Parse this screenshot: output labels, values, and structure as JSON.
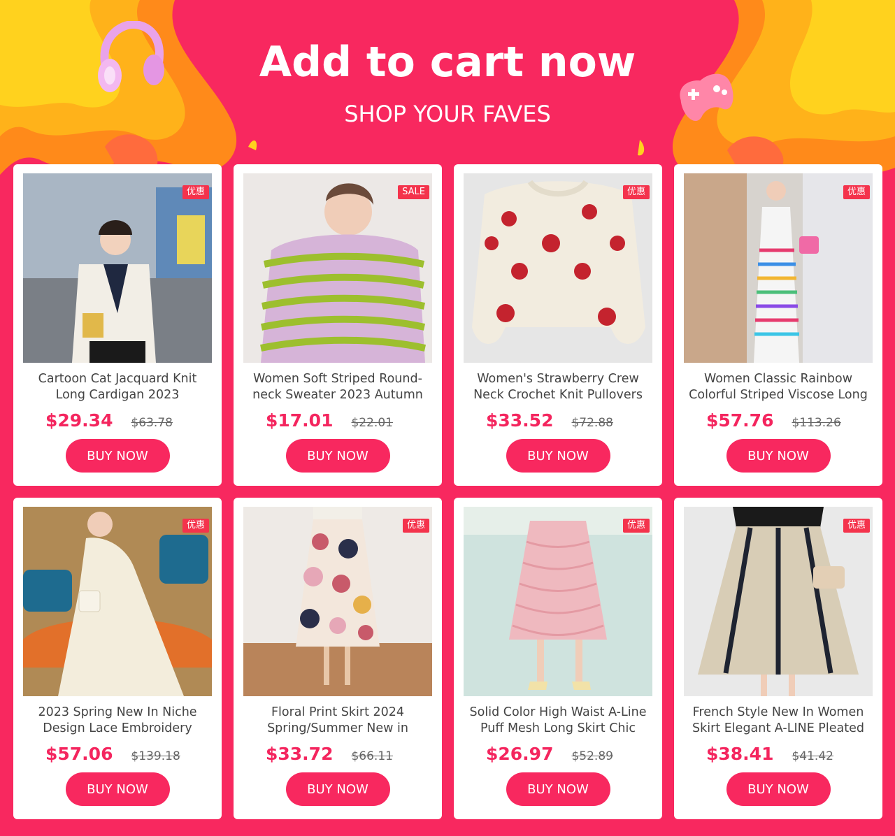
{
  "banner": {
    "headline": "Add to cart now",
    "subhead": "SHOP YOUR FAVES",
    "deco_left_icon": "headphones-icon",
    "deco_right_icon": "game-controller-icon"
  },
  "colors": {
    "background": "#f8285f",
    "accent_price": "#f4255e",
    "button": "#f8285f",
    "wave_orange": "#ff8a1a",
    "wave_yellow": "#ffd21e"
  },
  "products": [
    {
      "title": "Cartoon Cat Jacquard Knit Long Cardigan 2023",
      "price": "$29.34",
      "old_price": "$63.78",
      "badge": "优惠",
      "cta": "BUY NOW",
      "image": "cat-cardigan-photo"
    },
    {
      "title": "Women Soft Striped Round-neck Sweater 2023 Autumn",
      "price": "$17.01",
      "old_price": "$22.01",
      "badge": "SALE",
      "cta": "BUY NOW",
      "image": "striped-sweater-photo"
    },
    {
      "title": "Women's Strawberry Crew Neck Crochet Knit Pullovers",
      "price": "$33.52",
      "old_price": "$72.88",
      "badge": "优惠",
      "cta": "BUY NOW",
      "image": "strawberry-sweater-photo"
    },
    {
      "title": "Women Classic Rainbow Colorful Striped Viscose Long",
      "price": "$57.76",
      "old_price": "$113.26",
      "badge": "优惠",
      "cta": "BUY NOW",
      "image": "rainbow-dress-photo"
    },
    {
      "title": "2023 Spring New In Niche Design Lace Embroidery",
      "price": "$57.06",
      "old_price": "$139.18",
      "badge": "优惠",
      "cta": "BUY NOW",
      "image": "lace-dress-photo"
    },
    {
      "title": "Floral Print Skirt 2024 Spring/Summer New in",
      "price": "$33.72",
      "old_price": "$66.11",
      "badge": "优惠",
      "cta": "BUY NOW",
      "image": "floral-skirt-photo"
    },
    {
      "title": "Solid Color High Waist A-Line Puff Mesh Long Skirt Chic",
      "price": "$26.97",
      "old_price": "$52.89",
      "badge": "优惠",
      "cta": "BUY NOW",
      "image": "pink-tulle-skirt-photo"
    },
    {
      "title": "French Style New In Women Skirt Elegant A-LINE Pleated",
      "price": "$38.41",
      "old_price": "$41.42",
      "badge": "优惠",
      "cta": "BUY NOW",
      "image": "pleated-skirt-photo"
    }
  ]
}
